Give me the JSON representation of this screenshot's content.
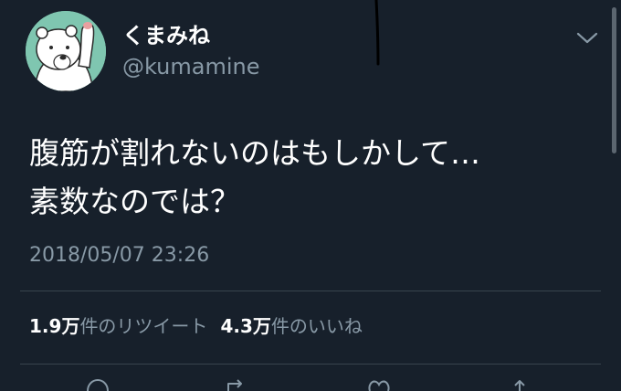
{
  "user": {
    "display_name": "くまみね",
    "handle": "@kumamine",
    "avatar": "polar-bear-avatar"
  },
  "tweet": {
    "lines": [
      "腹筋が割れないのはもしかして…",
      "素数なのでは？"
    ],
    "timestamp": "2018/05/07 23:26"
  },
  "stats": {
    "retweets": {
      "count": "1.9",
      "unit": "万",
      "label": "件のリツイート"
    },
    "likes": {
      "count": "4.3",
      "unit": "万",
      "label": "件のいいね"
    }
  },
  "icons": {
    "menu": "chevron-down-icon",
    "reply": "reply-icon",
    "retweet": "retweet-icon",
    "like": "heart-icon",
    "share": "share-icon"
  },
  "colors": {
    "background": "#17202b",
    "primary_text": "#ffffff",
    "secondary_text": "#8899a6",
    "divider": "#38444d",
    "avatar_bg": "#7fc6b0"
  }
}
